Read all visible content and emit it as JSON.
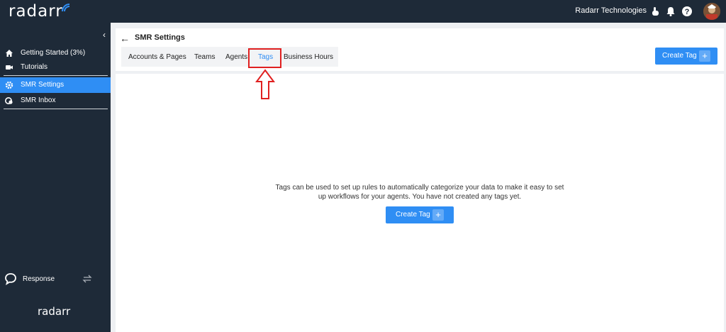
{
  "app": {
    "logo": "radarr",
    "footer_logo": "radarr"
  },
  "topbar": {
    "company": "Radarr Technologies",
    "icons": [
      "hand-pointer-icon",
      "bell-icon",
      "help-icon"
    ],
    "avatar": "user-avatar"
  },
  "sidebar": {
    "items": [
      {
        "label": "Getting Started (3%)",
        "icon": "home-icon"
      },
      {
        "label": "Tutorials",
        "icon": "video-icon"
      },
      {
        "label": "SMR Settings",
        "icon": "gear-icon",
        "active": true
      },
      {
        "label": "SMR Inbox",
        "icon": "inbox-icon"
      }
    ],
    "response_label": "Response"
  },
  "page": {
    "title": "SMR Settings",
    "tabs": [
      "Accounts & Pages",
      "Teams",
      "Agents",
      "Tags",
      "Business Hours"
    ],
    "active_tab": "Tags",
    "create_tag_label": "Create Tag",
    "empty_message": "Tags can be used to set up rules to automatically categorize your data to make it easy to set up workflows for your agents. You have not created any tags yet."
  },
  "colors": {
    "accent": "#2f8ef4",
    "sidebar": "#1e2a38",
    "highlight": "#e02020"
  }
}
